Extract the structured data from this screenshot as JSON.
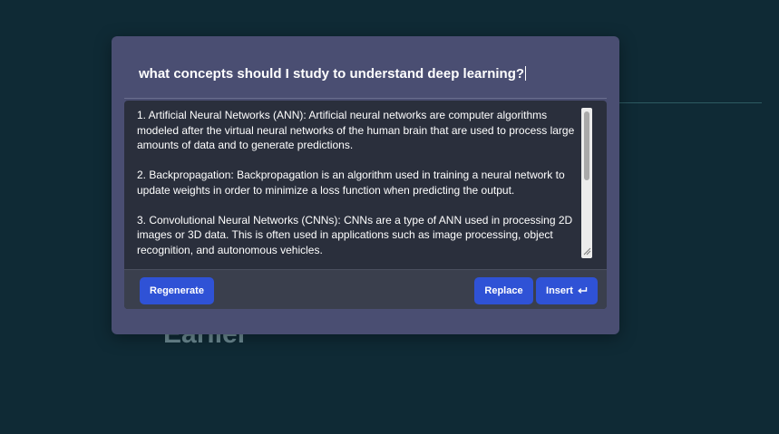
{
  "prompt": {
    "value": "what concepts should I study to understand deep learning?"
  },
  "result": {
    "text": "1. Artificial Neural Networks (ANN): Artificial neural networks are computer algorithms modeled after the virtual neural networks of the human brain that are used to process large amounts of data and to generate predictions.\n\n2. Backpropagation: Backpropagation is an algorithm used in training a neural network to update weights in order to minimize a loss function when predicting the output.\n\n3. Convolutional Neural Networks (CNNs): CNNs are a type of ANN used in processing 2D images or 3D data. This is often used in applications such as image processing, object recognition, and autonomous vehicles."
  },
  "actions": {
    "regenerate_label": "Regenerate",
    "replace_label": "Replace",
    "insert_label": "Insert"
  },
  "background": {
    "heading": "Earlier"
  },
  "icons": {
    "insert": "return-arrow-icon"
  },
  "colors": {
    "page_background": "#0f2a35",
    "modal_background": "#4a4e72",
    "result_background": "#2a2f3c",
    "button_primary": "#2f52d6"
  }
}
